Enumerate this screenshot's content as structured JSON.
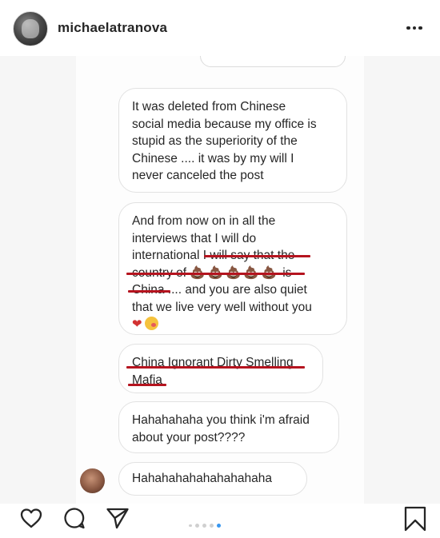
{
  "header": {
    "username": "michaelatranova",
    "more_icon": "more-options-icon"
  },
  "messages": [
    {
      "lines": [
        "It was deleted from Chinese",
        "social media because my office is",
        "stupid as the superiority of the",
        "Chinese .... it was by my will I",
        "never canceled the post"
      ]
    },
    {
      "lines": [
        "And from now on in all the",
        "interviews that I will do",
        "international I will say that the",
        "country of",
        "is",
        "China .... and you are also quiet",
        "that we live very well without you"
      ],
      "emojis": "💩💩💩💩💩",
      "heart": "❤"
    },
    {
      "lines": [
        "China Ignorant Dirty Smelling",
        "Mafia"
      ]
    },
    {
      "lines": [
        "Hahahahaha you think i'm afraid",
        "about your post????"
      ]
    },
    {
      "lines": [
        "Hahahahahahahahahaha"
      ]
    }
  ],
  "action_bar": {
    "icons": [
      "heart-icon",
      "comment-icon",
      "share-icon",
      "bookmark-icon"
    ],
    "carousel_dots": 5,
    "active_dot": 5
  },
  "colors": {
    "underline": "#b5141f",
    "active_dot": "#3897f0",
    "bubble_border": "#e2e2e2"
  }
}
